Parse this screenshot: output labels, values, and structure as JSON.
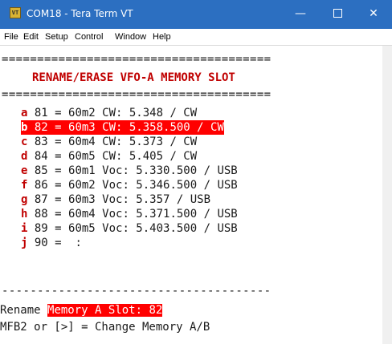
{
  "window": {
    "title": "COM18 - Tera Term VT",
    "app_icon_label": "VT",
    "controls": {
      "minimize": "—",
      "close": "✕"
    }
  },
  "menu": [
    "File",
    "Edit",
    "Setup",
    "Control",
    "Window",
    "Help"
  ],
  "terminal": {
    "rule_double": "======================================",
    "heading": "RENAME/ERASE VFO-A MEMORY SLOT",
    "items": [
      {
        "key": "a",
        "text": " 81 = 60m2 CW: 5.348 / CW"
      },
      {
        "key": "b",
        "text": " 82 = 60m3 CW: 5.358.500 / CW",
        "selected": true
      },
      {
        "key": "c",
        "text": " 83 = 60m4 CW: 5.373 / CW"
      },
      {
        "key": "d",
        "text": " 84 = 60m5 CW: 5.405 / CW"
      },
      {
        "key": "e",
        "text": " 85 = 60m1 Voc: 5.330.500 / USB"
      },
      {
        "key": "f",
        "text": " 86 = 60m2 Voc: 5.346.500 / USB"
      },
      {
        "key": "g",
        "text": " 87 = 60m3 Voc: 5.357 / USB"
      },
      {
        "key": "h",
        "text": " 88 = 60m4 Voc: 5.371.500 / USB"
      },
      {
        "key": "i",
        "text": " 89 = 60m5 Voc: 5.403.500 / USB"
      },
      {
        "key": "j",
        "text": " 90 =  :"
      }
    ],
    "rule_single": "--------------------------------------",
    "rename_prefix": "Rename ",
    "rename_highlight": "Memory A Slot: 82",
    "footer": "MFB2 or [>] = Change Memory A/B"
  },
  "colors": {
    "titlebar": "#2c6fc1",
    "highlight": "#ff0000",
    "key_letter": "#c00000"
  }
}
